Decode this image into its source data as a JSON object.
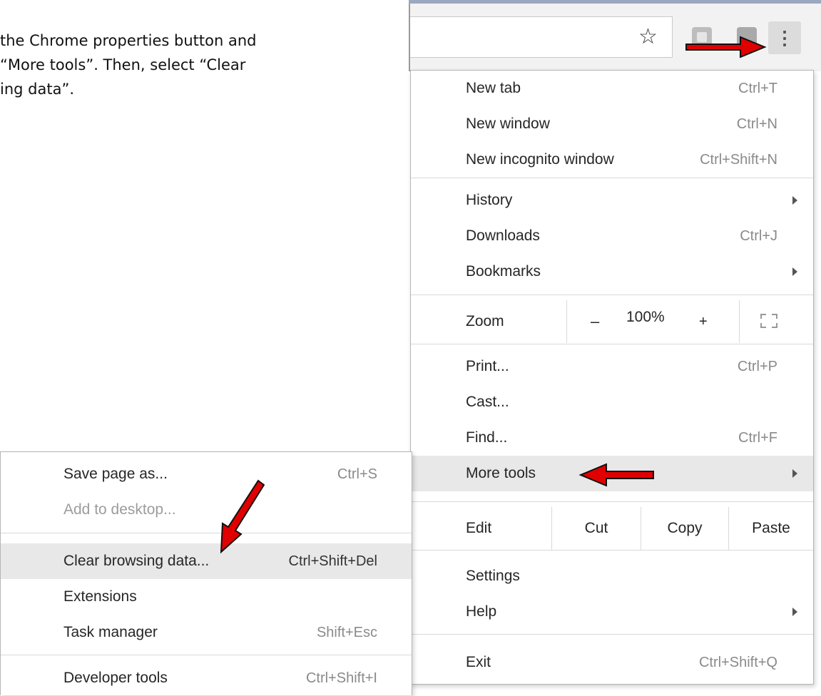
{
  "instructions": {
    "line1": "the Chrome properties button and",
    "line2": "“More tools”. Then, select “Clear",
    "line3": "ing data”."
  },
  "toolbar": {
    "bookmark_icon": "star-icon",
    "menu_icon": "three-dots-vertical-icon",
    "menu_glyph": "⋮"
  },
  "menu": {
    "new_tab": {
      "label": "New tab",
      "shortcut": "Ctrl+T"
    },
    "new_window": {
      "label": "New window",
      "shortcut": "Ctrl+N"
    },
    "new_incognito": {
      "label": "New incognito window",
      "shortcut": "Ctrl+Shift+N"
    },
    "history": {
      "label": "History"
    },
    "downloads": {
      "label": "Downloads",
      "shortcut": "Ctrl+J"
    },
    "bookmarks": {
      "label": "Bookmarks"
    },
    "zoom": {
      "label": "Zoom",
      "minus": "–",
      "value": "100%",
      "plus": "+"
    },
    "print": {
      "label": "Print...",
      "shortcut": "Ctrl+P"
    },
    "cast": {
      "label": "Cast..."
    },
    "find": {
      "label": "Find...",
      "shortcut": "Ctrl+F"
    },
    "more_tools": {
      "label": "More tools"
    },
    "edit": {
      "label": "Edit",
      "cut": "Cut",
      "copy": "Copy",
      "paste": "Paste"
    },
    "settings": {
      "label": "Settings"
    },
    "help": {
      "label": "Help"
    },
    "exit": {
      "label": "Exit",
      "shortcut": "Ctrl+Shift+Q"
    }
  },
  "submenu": {
    "save_page": {
      "label": "Save page as...",
      "shortcut": "Ctrl+S"
    },
    "add_desktop": {
      "label": "Add to desktop..."
    },
    "clear_data": {
      "label": "Clear browsing data...",
      "shortcut": "Ctrl+Shift+Del"
    },
    "extensions": {
      "label": "Extensions"
    },
    "task_manager": {
      "label": "Task manager",
      "shortcut": "Shift+Esc"
    },
    "dev_tools": {
      "label": "Developer tools",
      "shortcut": "Ctrl+Shift+I"
    }
  },
  "colors": {
    "annotation_arrow": "#e00000",
    "hover_row": "#e8e8e8"
  }
}
